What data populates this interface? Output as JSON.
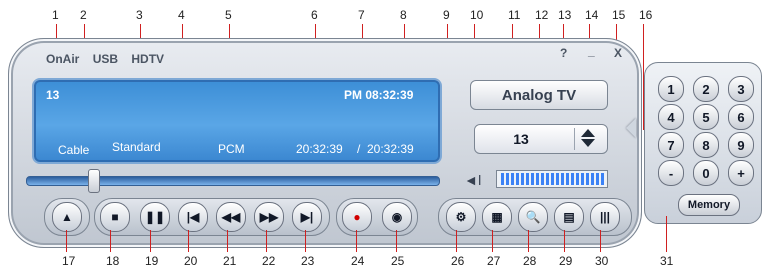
{
  "callouts_top": [
    "1",
    "2",
    "3",
    "4",
    "5",
    "6",
    "7",
    "8",
    "9",
    "10",
    "11",
    "12",
    "13",
    "14",
    "15",
    "16"
  ],
  "callouts_bottom": [
    "17",
    "18",
    "19",
    "20",
    "21",
    "22",
    "23",
    "24",
    "25",
    "26",
    "27",
    "28",
    "29",
    "30",
    "31"
  ],
  "source_tabs": [
    "OnAir",
    "USB",
    "HDTV"
  ],
  "window_buttons": {
    "help": "?",
    "minimize": "_",
    "close": "X"
  },
  "lcd": {
    "channel": "13",
    "clock": "PM 08:32:39",
    "input": "Cable",
    "mode": "Standard",
    "audio": "PCM",
    "time_elapsed": "20:32:39",
    "time_sep": "/",
    "time_total": "20:32:39"
  },
  "big_button_label": "Analog TV",
  "channel_selector": {
    "value": "13"
  },
  "volume": {
    "level_pct": 100
  },
  "transport": {
    "eject": "▲",
    "stop": "■",
    "pause": "❚❚",
    "prev": "|◀",
    "rew": "◀◀",
    "ffw": "▶▶",
    "next": "▶|",
    "record": "●",
    "snapshot": "◉",
    "settings": "⚙",
    "multiview": "▦",
    "zoom": "🔍",
    "schedule": "▤",
    "bars": "|||"
  },
  "keypad": [
    "1",
    "2",
    "3",
    "4",
    "5",
    "6",
    "7",
    "8",
    "9",
    "-",
    "0",
    "+"
  ],
  "memory_label": "Memory"
}
